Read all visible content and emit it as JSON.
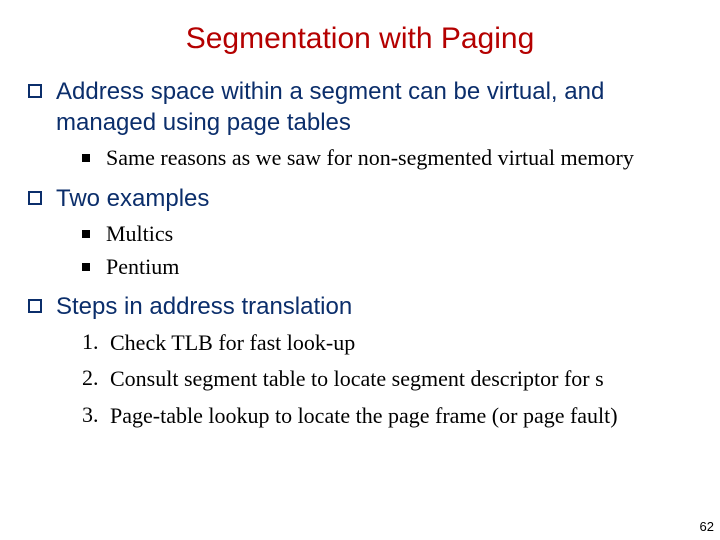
{
  "title": "Segmentation with Paging",
  "bullets": {
    "b1": {
      "text": "Address space within a segment can be virtual, and managed using page tables",
      "sub": {
        "s1": "Same reasons as we saw for non-segmented virtual memory"
      }
    },
    "b2": {
      "text": "Two examples",
      "sub": {
        "s1": "Multics",
        "s2": "Pentium"
      }
    },
    "b3": {
      "text": "Steps in address translation",
      "num": {
        "n1": {
          "marker": "1.",
          "text": "Check TLB for fast look-up"
        },
        "n2": {
          "marker": "2.",
          "text": "Consult segment table to locate segment descriptor for s"
        },
        "n3": {
          "marker": "3.",
          "text": "Page-table lookup to locate the page frame (or page fault)"
        }
      }
    }
  },
  "pageNumber": "62"
}
